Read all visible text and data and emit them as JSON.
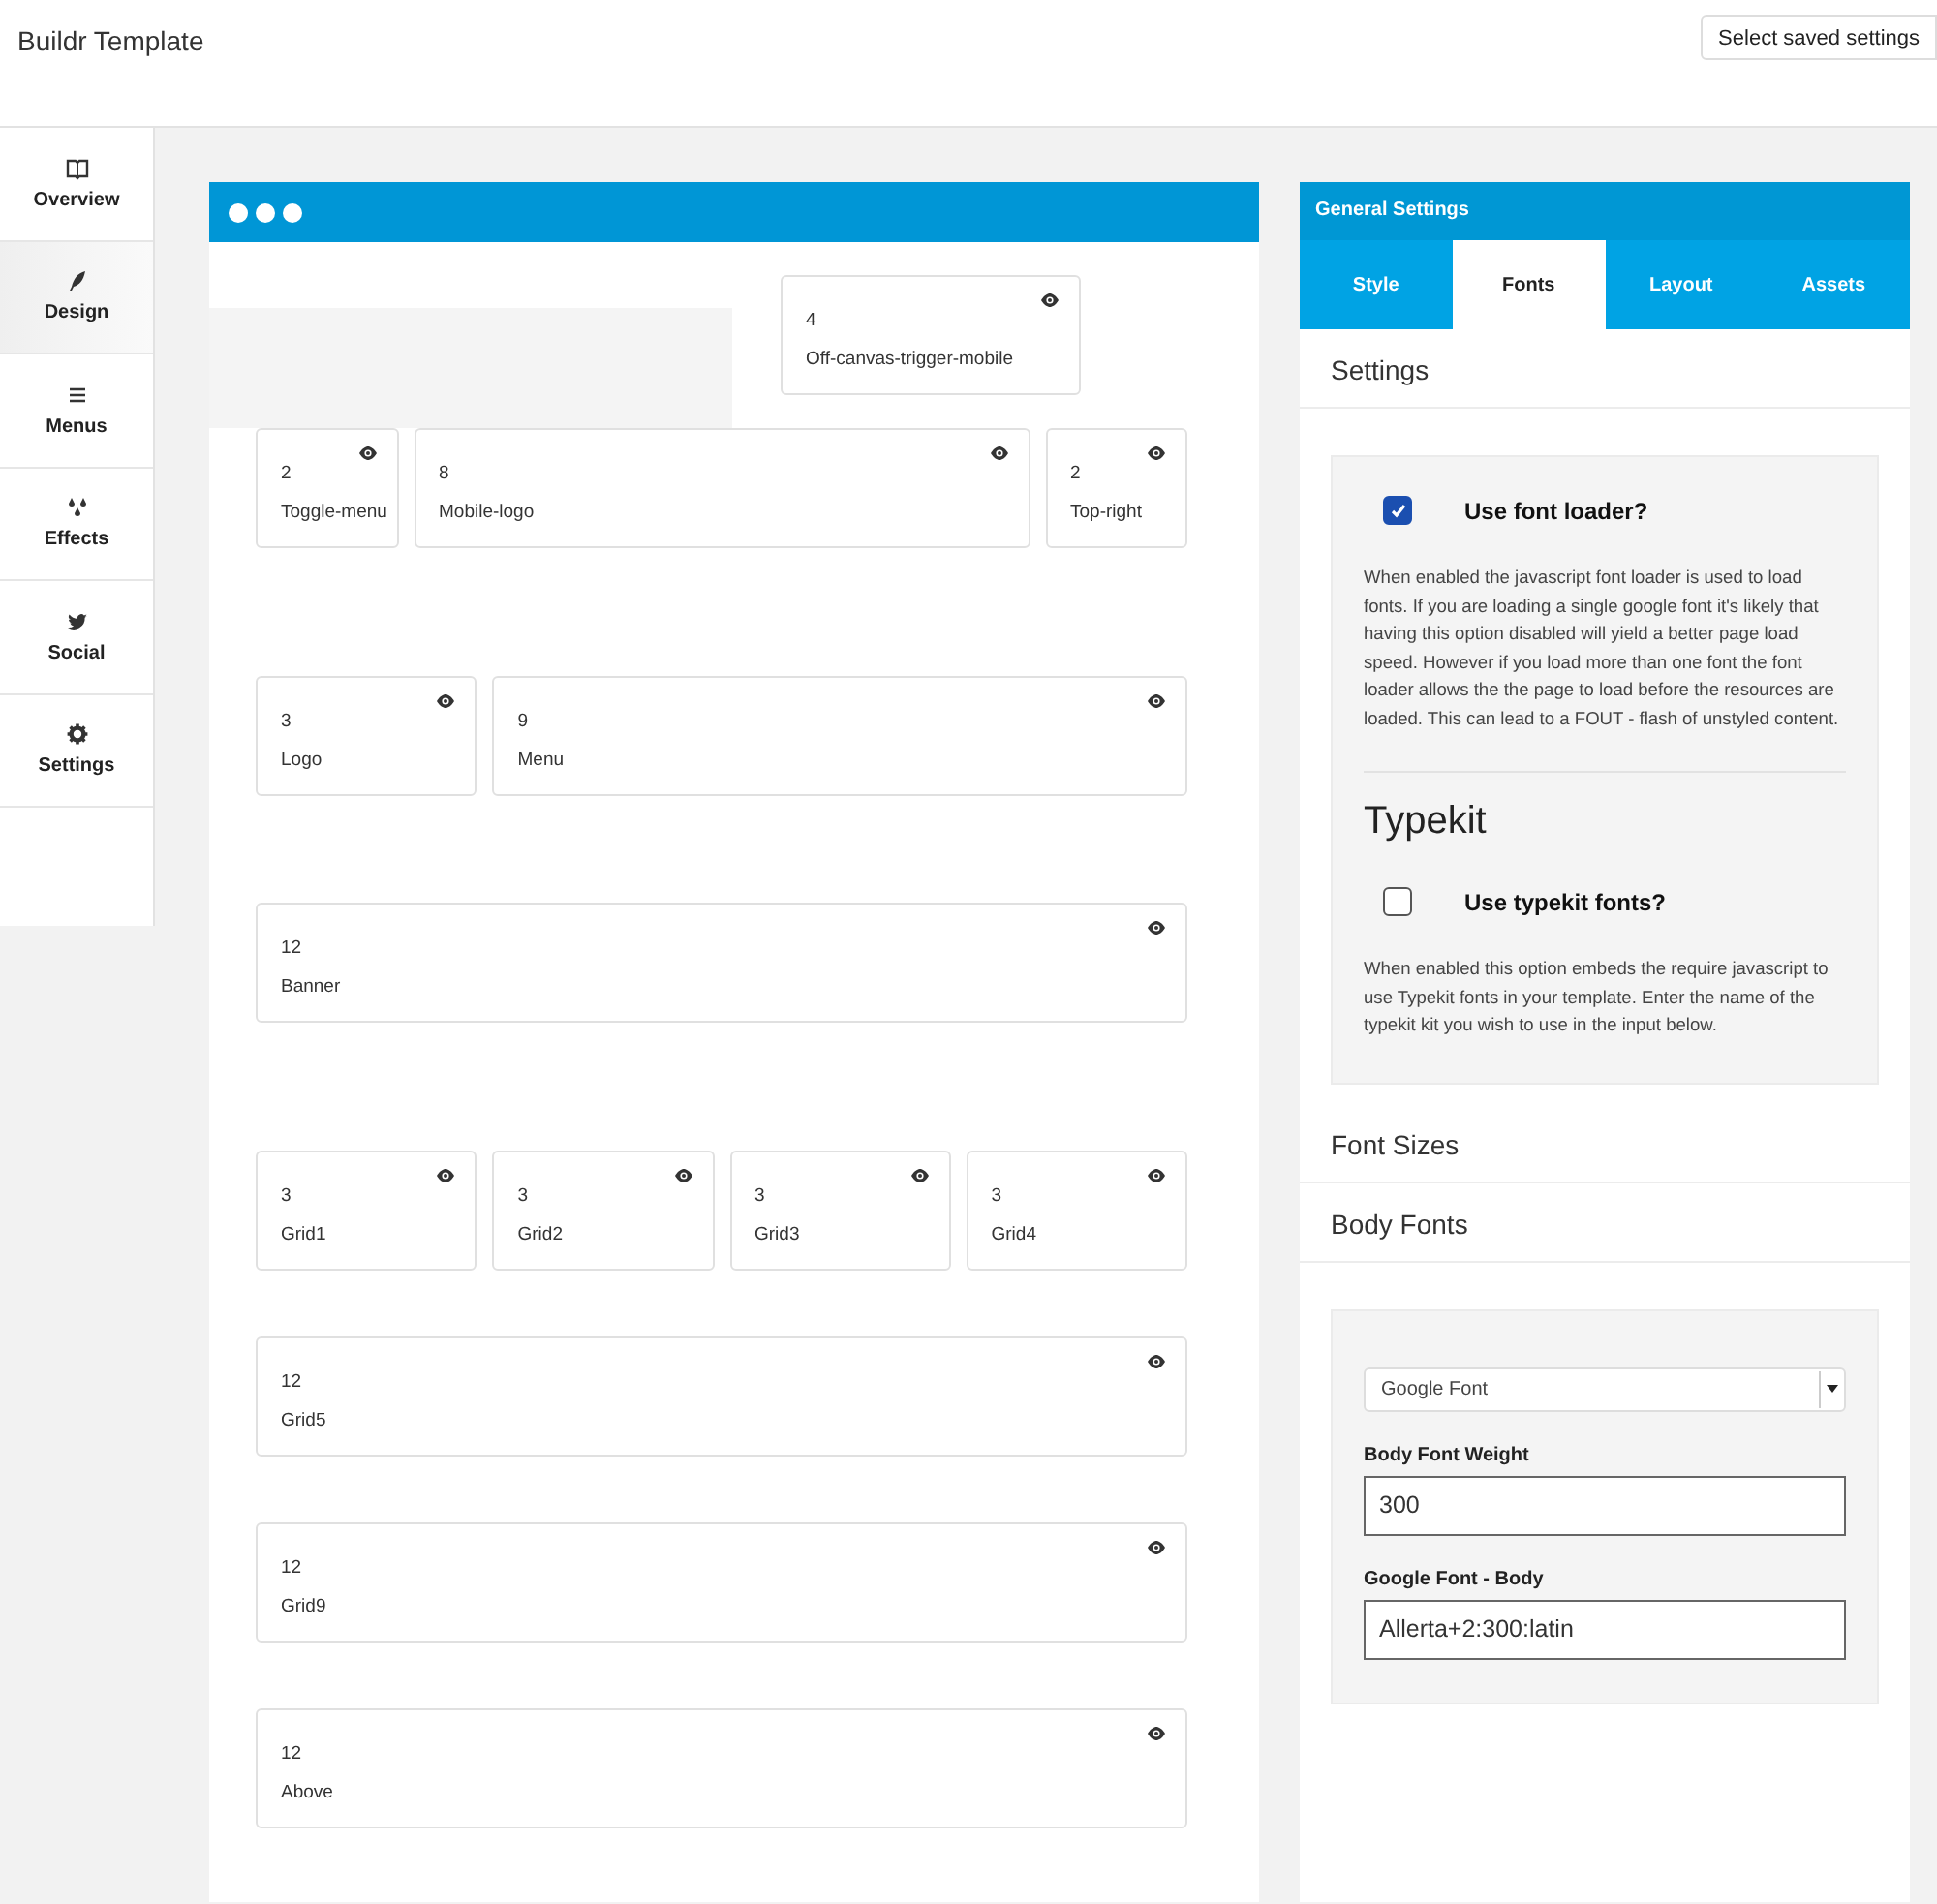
{
  "header": {
    "title": "Buildr Template",
    "saved_settings": "Select saved settings"
  },
  "sidebar": {
    "items": [
      {
        "label": "Overview",
        "selected": false
      },
      {
        "label": "Design",
        "selected": true
      },
      {
        "label": "Menus",
        "selected": false
      },
      {
        "label": "Effects",
        "selected": false
      },
      {
        "label": "Social",
        "selected": false
      },
      {
        "label": "Settings",
        "selected": false
      }
    ]
  },
  "canvas": {
    "rows": [
      {
        "kind": "with-empty-area",
        "cards": [
          {
            "span": "4",
            "name": "Off-canvas-trigger-mobile"
          }
        ]
      },
      {
        "kind": "grid",
        "cards": [
          {
            "span": "2",
            "name": "Toggle-menu"
          },
          {
            "span": "8",
            "name": "Mobile-logo"
          },
          {
            "span": "2",
            "name": "Top-right"
          }
        ]
      },
      {
        "kind": "grid",
        "cards": [
          {
            "span": "3",
            "name": "Logo"
          },
          {
            "span": "9",
            "name": "Menu"
          }
        ]
      },
      {
        "kind": "grid",
        "cards": [
          {
            "span": "12",
            "name": "Banner"
          }
        ]
      },
      {
        "kind": "grid",
        "cards": [
          {
            "span": "3",
            "name": "Grid1"
          },
          {
            "span": "3",
            "name": "Grid2"
          },
          {
            "span": "3",
            "name": "Grid3"
          },
          {
            "span": "3",
            "name": "Grid4"
          }
        ]
      },
      {
        "kind": "grid",
        "cards": [
          {
            "span": "12",
            "name": "Grid5"
          }
        ]
      },
      {
        "kind": "grid",
        "cards": [
          {
            "span": "12",
            "name": "Grid9"
          }
        ]
      },
      {
        "kind": "grid",
        "cards": [
          {
            "span": "12",
            "name": "Above"
          }
        ]
      }
    ]
  },
  "settings_panel": {
    "title": "General Settings",
    "tabs": [
      {
        "label": "Style",
        "selected": false
      },
      {
        "label": "Fonts",
        "selected": true
      },
      {
        "label": "Layout",
        "selected": false
      },
      {
        "label": "Assets",
        "selected": false
      }
    ],
    "sections": [
      {
        "kind": "heading",
        "title": "Settings"
      },
      {
        "kind": "box",
        "items": [
          {
            "kind": "checkbox",
            "label": "Use font loader?",
            "checked": true
          },
          {
            "kind": "text",
            "text": "When enabled the javascript font loader is used to load fonts. If you are loading a single google font it's likely that having this option disabled will yield a better page load speed. However if you load more than one font the font loader allows the the page to load before the resources are loaded. This can lead to a FOUT - flash of unstyled content."
          },
          {
            "kind": "subheading",
            "text": "Typekit"
          },
          {
            "kind": "checkbox",
            "label": "Use typekit fonts?",
            "checked": false
          },
          {
            "kind": "text",
            "text": "When enabled this option embeds the require javascript to use Typekit fonts in your template. Enter the name of the typekit kit you wish to use in the input below."
          }
        ]
      },
      {
        "kind": "heading",
        "title": "Font Sizes"
      },
      {
        "kind": "heading",
        "title": "Body Fonts"
      },
      {
        "kind": "box",
        "items": [
          {
            "kind": "select",
            "value": "Google Font"
          },
          {
            "kind": "field",
            "label": "Body Font Weight",
            "value": "300"
          },
          {
            "kind": "field",
            "label": "Google Font - Body",
            "value": "Allerta+2:300:latin"
          }
        ]
      }
    ]
  }
}
